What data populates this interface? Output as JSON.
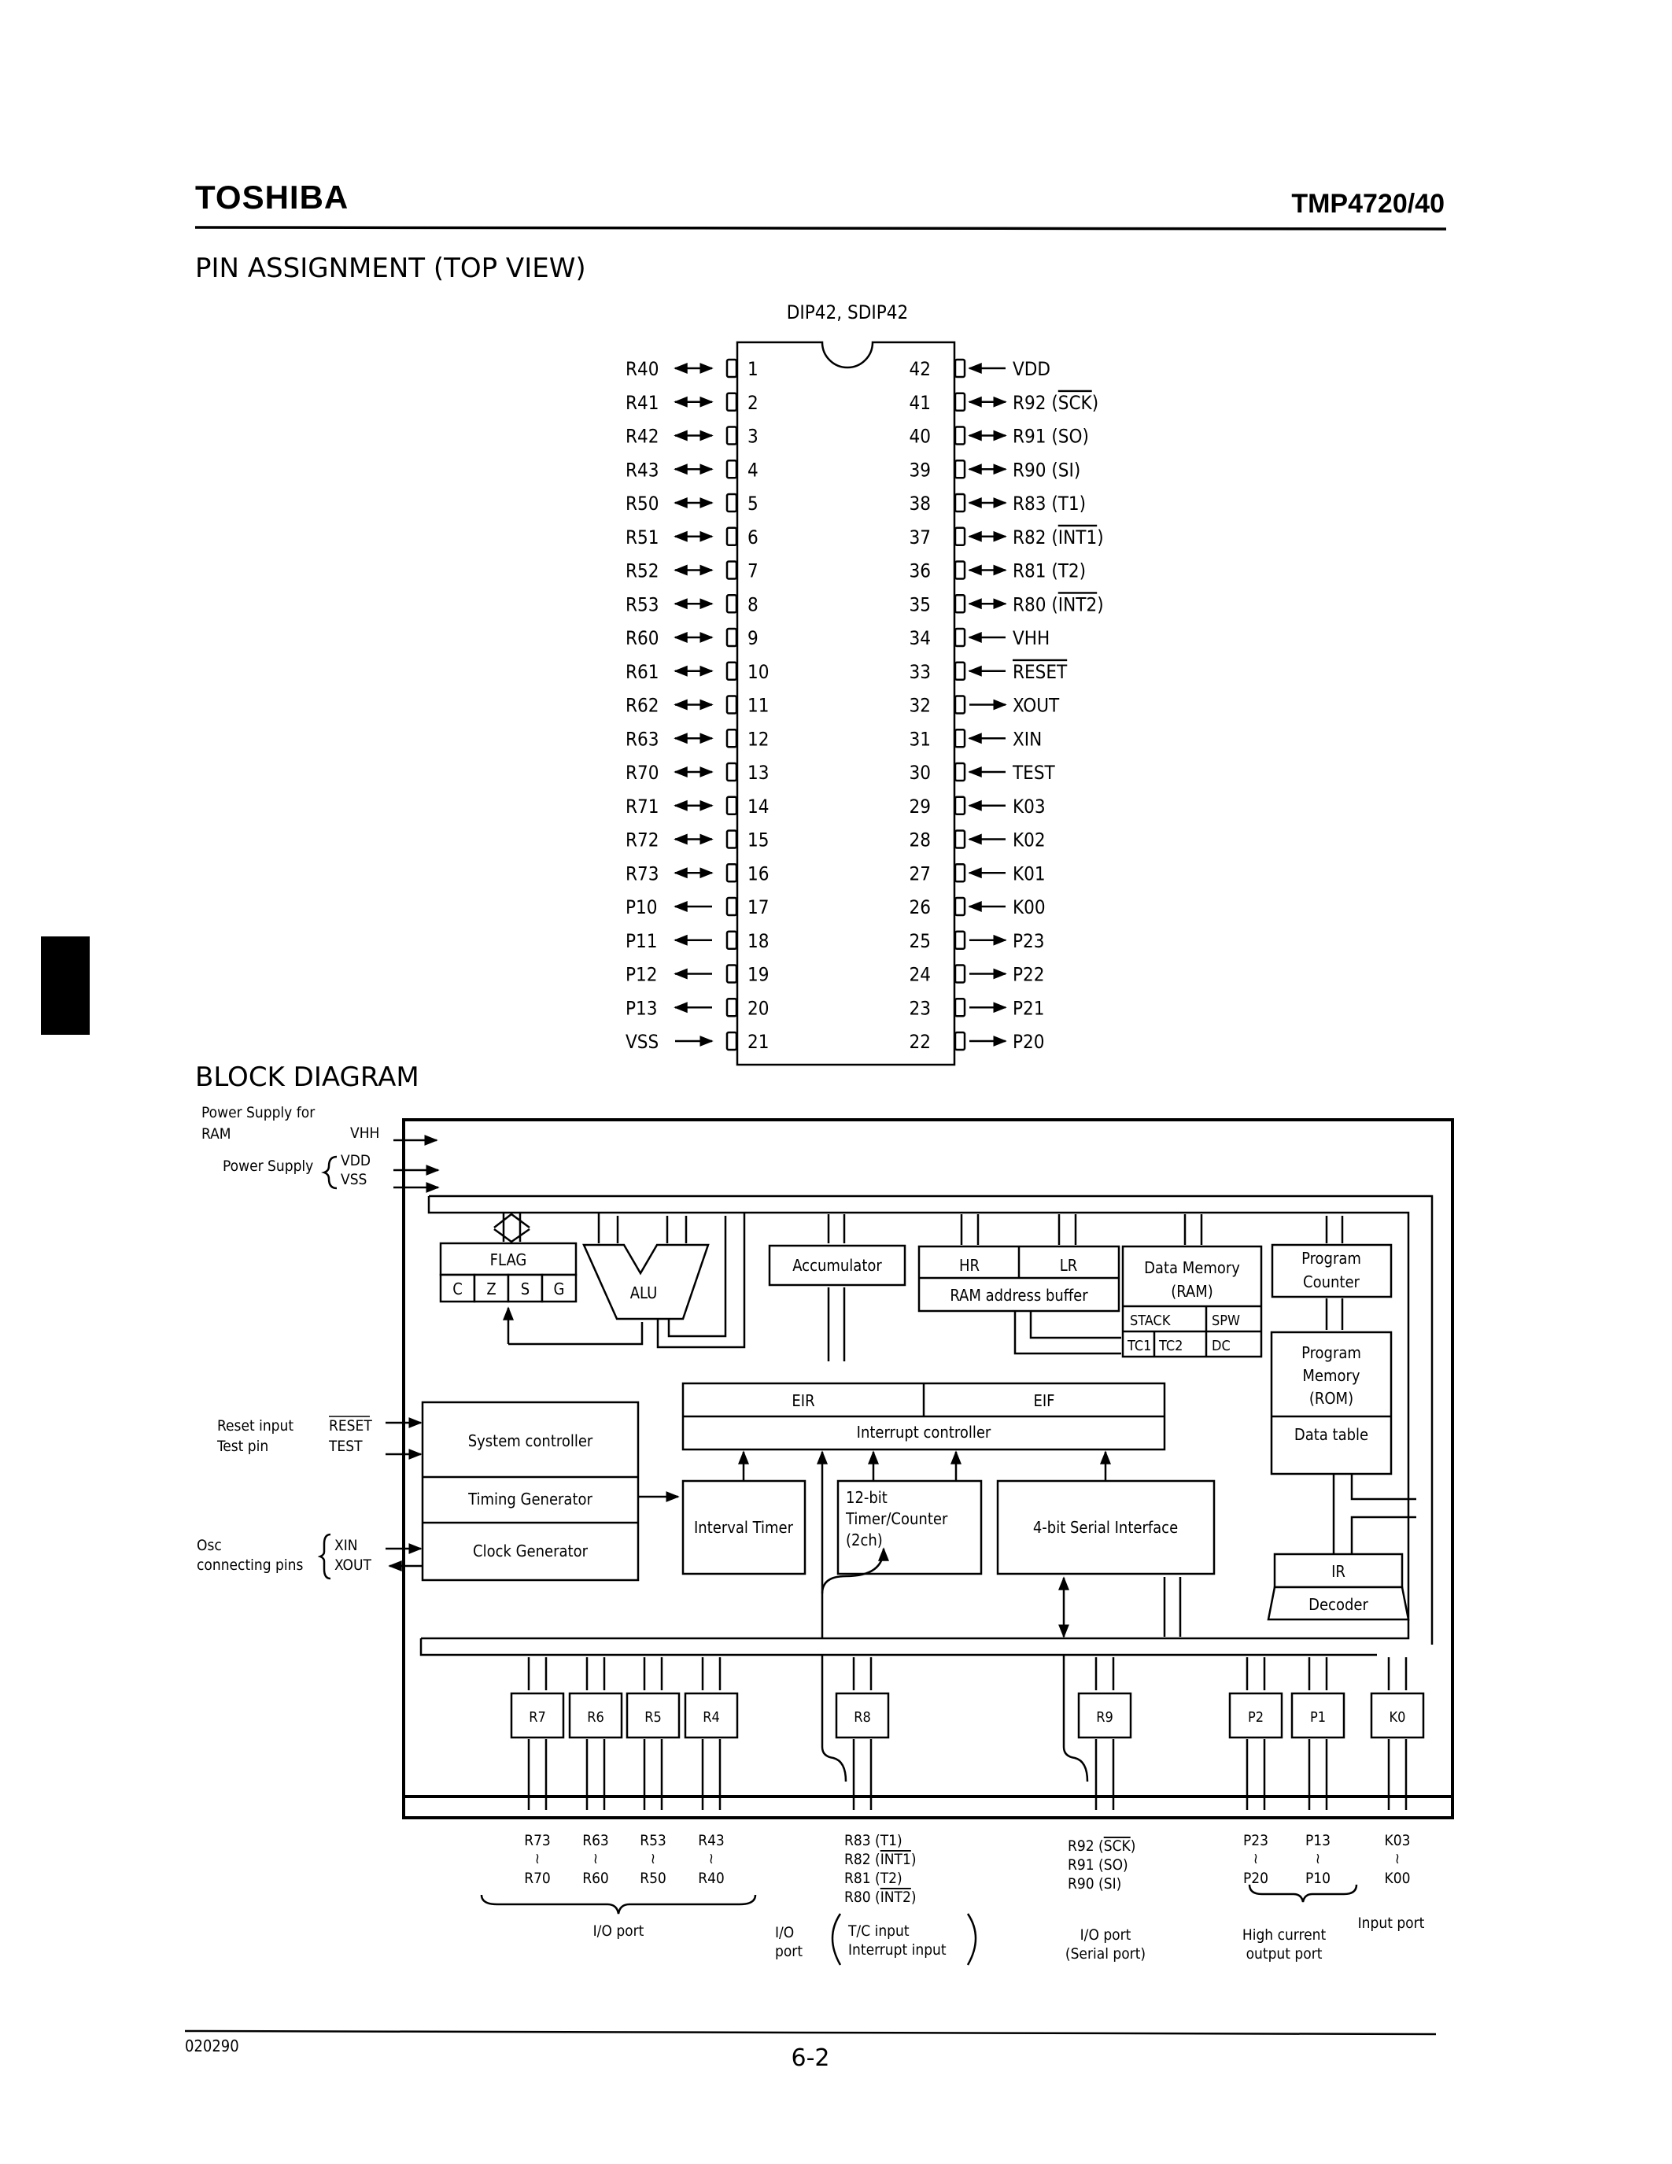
{
  "header": {
    "brand": "TOSHIBA",
    "part_number": "TMP4720/40"
  },
  "pin_assignment": {
    "title": "PIN ASSIGNMENT (TOP VIEW)",
    "package": "DIP42, SDIP42",
    "left_pins": [
      {
        "num": "1",
        "name": "R40",
        "dir": "bi"
      },
      {
        "num": "2",
        "name": "R41",
        "dir": "bi"
      },
      {
        "num": "3",
        "name": "R42",
        "dir": "bi"
      },
      {
        "num": "4",
        "name": "R43",
        "dir": "bi"
      },
      {
        "num": "5",
        "name": "R50",
        "dir": "bi"
      },
      {
        "num": "6",
        "name": "R51",
        "dir": "bi"
      },
      {
        "num": "7",
        "name": "R52",
        "dir": "bi"
      },
      {
        "num": "8",
        "name": "R53",
        "dir": "bi"
      },
      {
        "num": "9",
        "name": "R60",
        "dir": "bi"
      },
      {
        "num": "10",
        "name": "R61",
        "dir": "bi"
      },
      {
        "num": "11",
        "name": "R62",
        "dir": "bi"
      },
      {
        "num": "12",
        "name": "R63",
        "dir": "bi"
      },
      {
        "num": "13",
        "name": "R70",
        "dir": "bi"
      },
      {
        "num": "14",
        "name": "R71",
        "dir": "bi"
      },
      {
        "num": "15",
        "name": "R72",
        "dir": "bi"
      },
      {
        "num": "16",
        "name": "R73",
        "dir": "bi"
      },
      {
        "num": "17",
        "name": "P10",
        "dir": "out"
      },
      {
        "num": "18",
        "name": "P11",
        "dir": "out"
      },
      {
        "num": "19",
        "name": "P12",
        "dir": "out"
      },
      {
        "num": "20",
        "name": "P13",
        "dir": "out"
      },
      {
        "num": "21",
        "name": "VSS",
        "dir": "in"
      }
    ],
    "right_pins": [
      {
        "num": "42",
        "name": "VDD",
        "overline": "",
        "dir": "in"
      },
      {
        "num": "41",
        "name": "R92 (",
        "overline": "SCK",
        "suffix": ")",
        "dir": "bi"
      },
      {
        "num": "40",
        "name": "R91 (SO)",
        "overline": "",
        "dir": "bi"
      },
      {
        "num": "39",
        "name": "R90 (SI)",
        "overline": "",
        "dir": "bi"
      },
      {
        "num": "38",
        "name": "R83 (T1)",
        "overline": "",
        "dir": "bi"
      },
      {
        "num": "37",
        "name": "R82 (",
        "overline": "INT1",
        "suffix": ")",
        "dir": "bi"
      },
      {
        "num": "36",
        "name": "R81 (T2)",
        "overline": "",
        "dir": "bi"
      },
      {
        "num": "35",
        "name": "R80 (",
        "overline": "INT2",
        "suffix": ")",
        "dir": "bi"
      },
      {
        "num": "34",
        "name": "VHH",
        "overline": "",
        "dir": "in"
      },
      {
        "num": "33",
        "name": "",
        "overline": "RESET",
        "dir": "in"
      },
      {
        "num": "32",
        "name": "XOUT",
        "overline": "",
        "dir": "out"
      },
      {
        "num": "31",
        "name": "XIN",
        "overline": "",
        "dir": "in"
      },
      {
        "num": "30",
        "name": "TEST",
        "overline": "",
        "dir": "in"
      },
      {
        "num": "29",
        "name": "K03",
        "overline": "",
        "dir": "in"
      },
      {
        "num": "28",
        "name": "K02",
        "overline": "",
        "dir": "in"
      },
      {
        "num": "27",
        "name": "K01",
        "overline": "",
        "dir": "in"
      },
      {
        "num": "26",
        "name": "K00",
        "overline": "",
        "dir": "in"
      },
      {
        "num": "25",
        "name": "P23",
        "overline": "",
        "dir": "out"
      },
      {
        "num": "24",
        "name": "P22",
        "overline": "",
        "dir": "out"
      },
      {
        "num": "23",
        "name": "P21",
        "overline": "",
        "dir": "out"
      },
      {
        "num": "22",
        "name": "P20",
        "overline": "",
        "dir": "out"
      }
    ]
  },
  "block_diagram": {
    "title": "BLOCK DIAGRAM",
    "ext_inputs": {
      "power_ram_line1": "Power Supply for",
      "power_ram_line2": "RAM",
      "vhh": "VHH",
      "power_supply": "Power Supply",
      "vdd": "VDD",
      "vss": "VSS",
      "reset_label": "Reset input",
      "reset_pin": "RESET",
      "test_label": "Test pin",
      "test_pin": "TEST",
      "osc_line1": "Osc",
      "osc_line2": "connecting pins",
      "xin": "XIN",
      "xout": "XOUT"
    },
    "blocks": {
      "flag": "FLAG",
      "flag_bits": [
        "C",
        "Z",
        "S",
        "G"
      ],
      "alu": "ALU",
      "accumulator": "Accumulator",
      "hr": "HR",
      "lr": "LR",
      "ram_addr_buffer": "RAM address buffer",
      "data_memory_line1": "Data Memory",
      "data_memory_line2": "(RAM)",
      "stack": "STACK",
      "spw": "SPW",
      "tc1": "TC1",
      "tc2": "TC2",
      "dc": "DC",
      "program_counter_line1": "Program",
      "program_counter_line2": "Counter",
      "program_memory_line1": "Program",
      "program_memory_line2": "Memory",
      "program_memory_line3": "(ROM)",
      "data_table": "Data table",
      "eir": "EIR",
      "eif": "EIF",
      "interrupt_controller": "Interrupt controller",
      "system_controller": "System controller",
      "timing_generator": "Timing Generator",
      "clock_generator": "Clock Generator",
      "interval_timer": "Interval Timer",
      "timer_counter_line1": "12-bit",
      "timer_counter_line2": "Timer/Counter",
      "timer_counter_line3": "(2ch)",
      "serial_interface": "4-bit Serial Interface",
      "ir": "IR",
      "decoder": "Decoder"
    },
    "ports": [
      {
        "id": "R7",
        "hi": "R73",
        "lo": "R70"
      },
      {
        "id": "R6",
        "hi": "R63",
        "lo": "R60"
      },
      {
        "id": "R5",
        "hi": "R53",
        "lo": "R50"
      },
      {
        "id": "R4",
        "hi": "R43",
        "lo": "R40"
      },
      {
        "id": "R8"
      },
      {
        "id": "R9"
      },
      {
        "id": "P2",
        "hi": "P23",
        "lo": "P20"
      },
      {
        "id": "P1",
        "hi": "P13",
        "lo": "P10"
      },
      {
        "id": "K0",
        "hi": "K03",
        "lo": "K00"
      }
    ],
    "range_symbol": "≀",
    "port_labels": {
      "r4_7_group": "I/O port",
      "r8_lines": [
        {
          "text": "R83 (T1)",
          "over": ""
        },
        {
          "text": "R82 (",
          "over": "INT1",
          "suffix": ")"
        },
        {
          "text": "R81 (T2)",
          "over": ""
        },
        {
          "text": "R80 (",
          "over": "INT2",
          "suffix": ")"
        }
      ],
      "r8_io_line1": "I/O",
      "r8_io_line2": "port",
      "r8_func_line1": "T/C input",
      "r8_func_line2": "Interrupt input",
      "r9_lines": [
        {
          "text": "R92 (",
          "over": "SCK",
          "suffix": ")"
        },
        {
          "text": "R91 (SO)",
          "over": ""
        },
        {
          "text": "R90 (SI)",
          "over": ""
        }
      ],
      "r9_group_line1": "I/O port",
      "r9_group_line2": "(Serial port)",
      "p_group_line1": "High current",
      "p_group_line2": "output port",
      "k_group": "Input port"
    }
  },
  "footer": {
    "doc_code": "020290",
    "page": "6-2"
  }
}
